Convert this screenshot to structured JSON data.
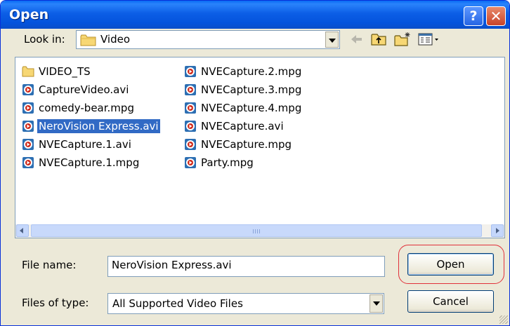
{
  "window": {
    "title": "Open"
  },
  "title_buttons": {
    "help": "?",
    "close": "✕"
  },
  "look_in": {
    "label": "Look in:",
    "value": "Video"
  },
  "files": [
    {
      "name": "VIDEO_TS",
      "icon": "folder-icon",
      "col": 0,
      "row": 0
    },
    {
      "name": "CaptureVideo.avi",
      "icon": "video-file-icon",
      "col": 0,
      "row": 1
    },
    {
      "name": "comedy-bear.mpg",
      "icon": "video-file-icon",
      "col": 0,
      "row": 2
    },
    {
      "name": "NeroVision Express.avi",
      "icon": "video-file-icon",
      "col": 0,
      "row": 3,
      "selected": true
    },
    {
      "name": "NVECapture.1.avi",
      "icon": "video-file-icon",
      "col": 0,
      "row": 4
    },
    {
      "name": "NVECapture.1.mpg",
      "icon": "video-file-icon",
      "col": 0,
      "row": 5
    },
    {
      "name": "NVECapture.2.mpg",
      "icon": "video-file-icon",
      "col": 1,
      "row": 0
    },
    {
      "name": "NVECapture.3.mpg",
      "icon": "video-file-icon",
      "col": 1,
      "row": 1
    },
    {
      "name": "NVECapture.4.mpg",
      "icon": "video-file-icon",
      "col": 1,
      "row": 2
    },
    {
      "name": "NVECapture.avi",
      "icon": "video-file-icon",
      "col": 1,
      "row": 3
    },
    {
      "name": "NVECapture.mpg",
      "icon": "video-file-icon",
      "col": 1,
      "row": 4
    },
    {
      "name": "Party.mpg",
      "icon": "video-file-icon",
      "col": 1,
      "row": 5
    }
  ],
  "file_name": {
    "label": "File name:",
    "value": "NeroVision Express.avi"
  },
  "file_type": {
    "label": "Files of type:",
    "value": "All Supported Video Files"
  },
  "buttons": {
    "open": "Open",
    "cancel": "Cancel"
  },
  "colors": {
    "selection": "#316ac5",
    "highlight_ring": "#e0303a",
    "title_blue": "#0453dc"
  }
}
